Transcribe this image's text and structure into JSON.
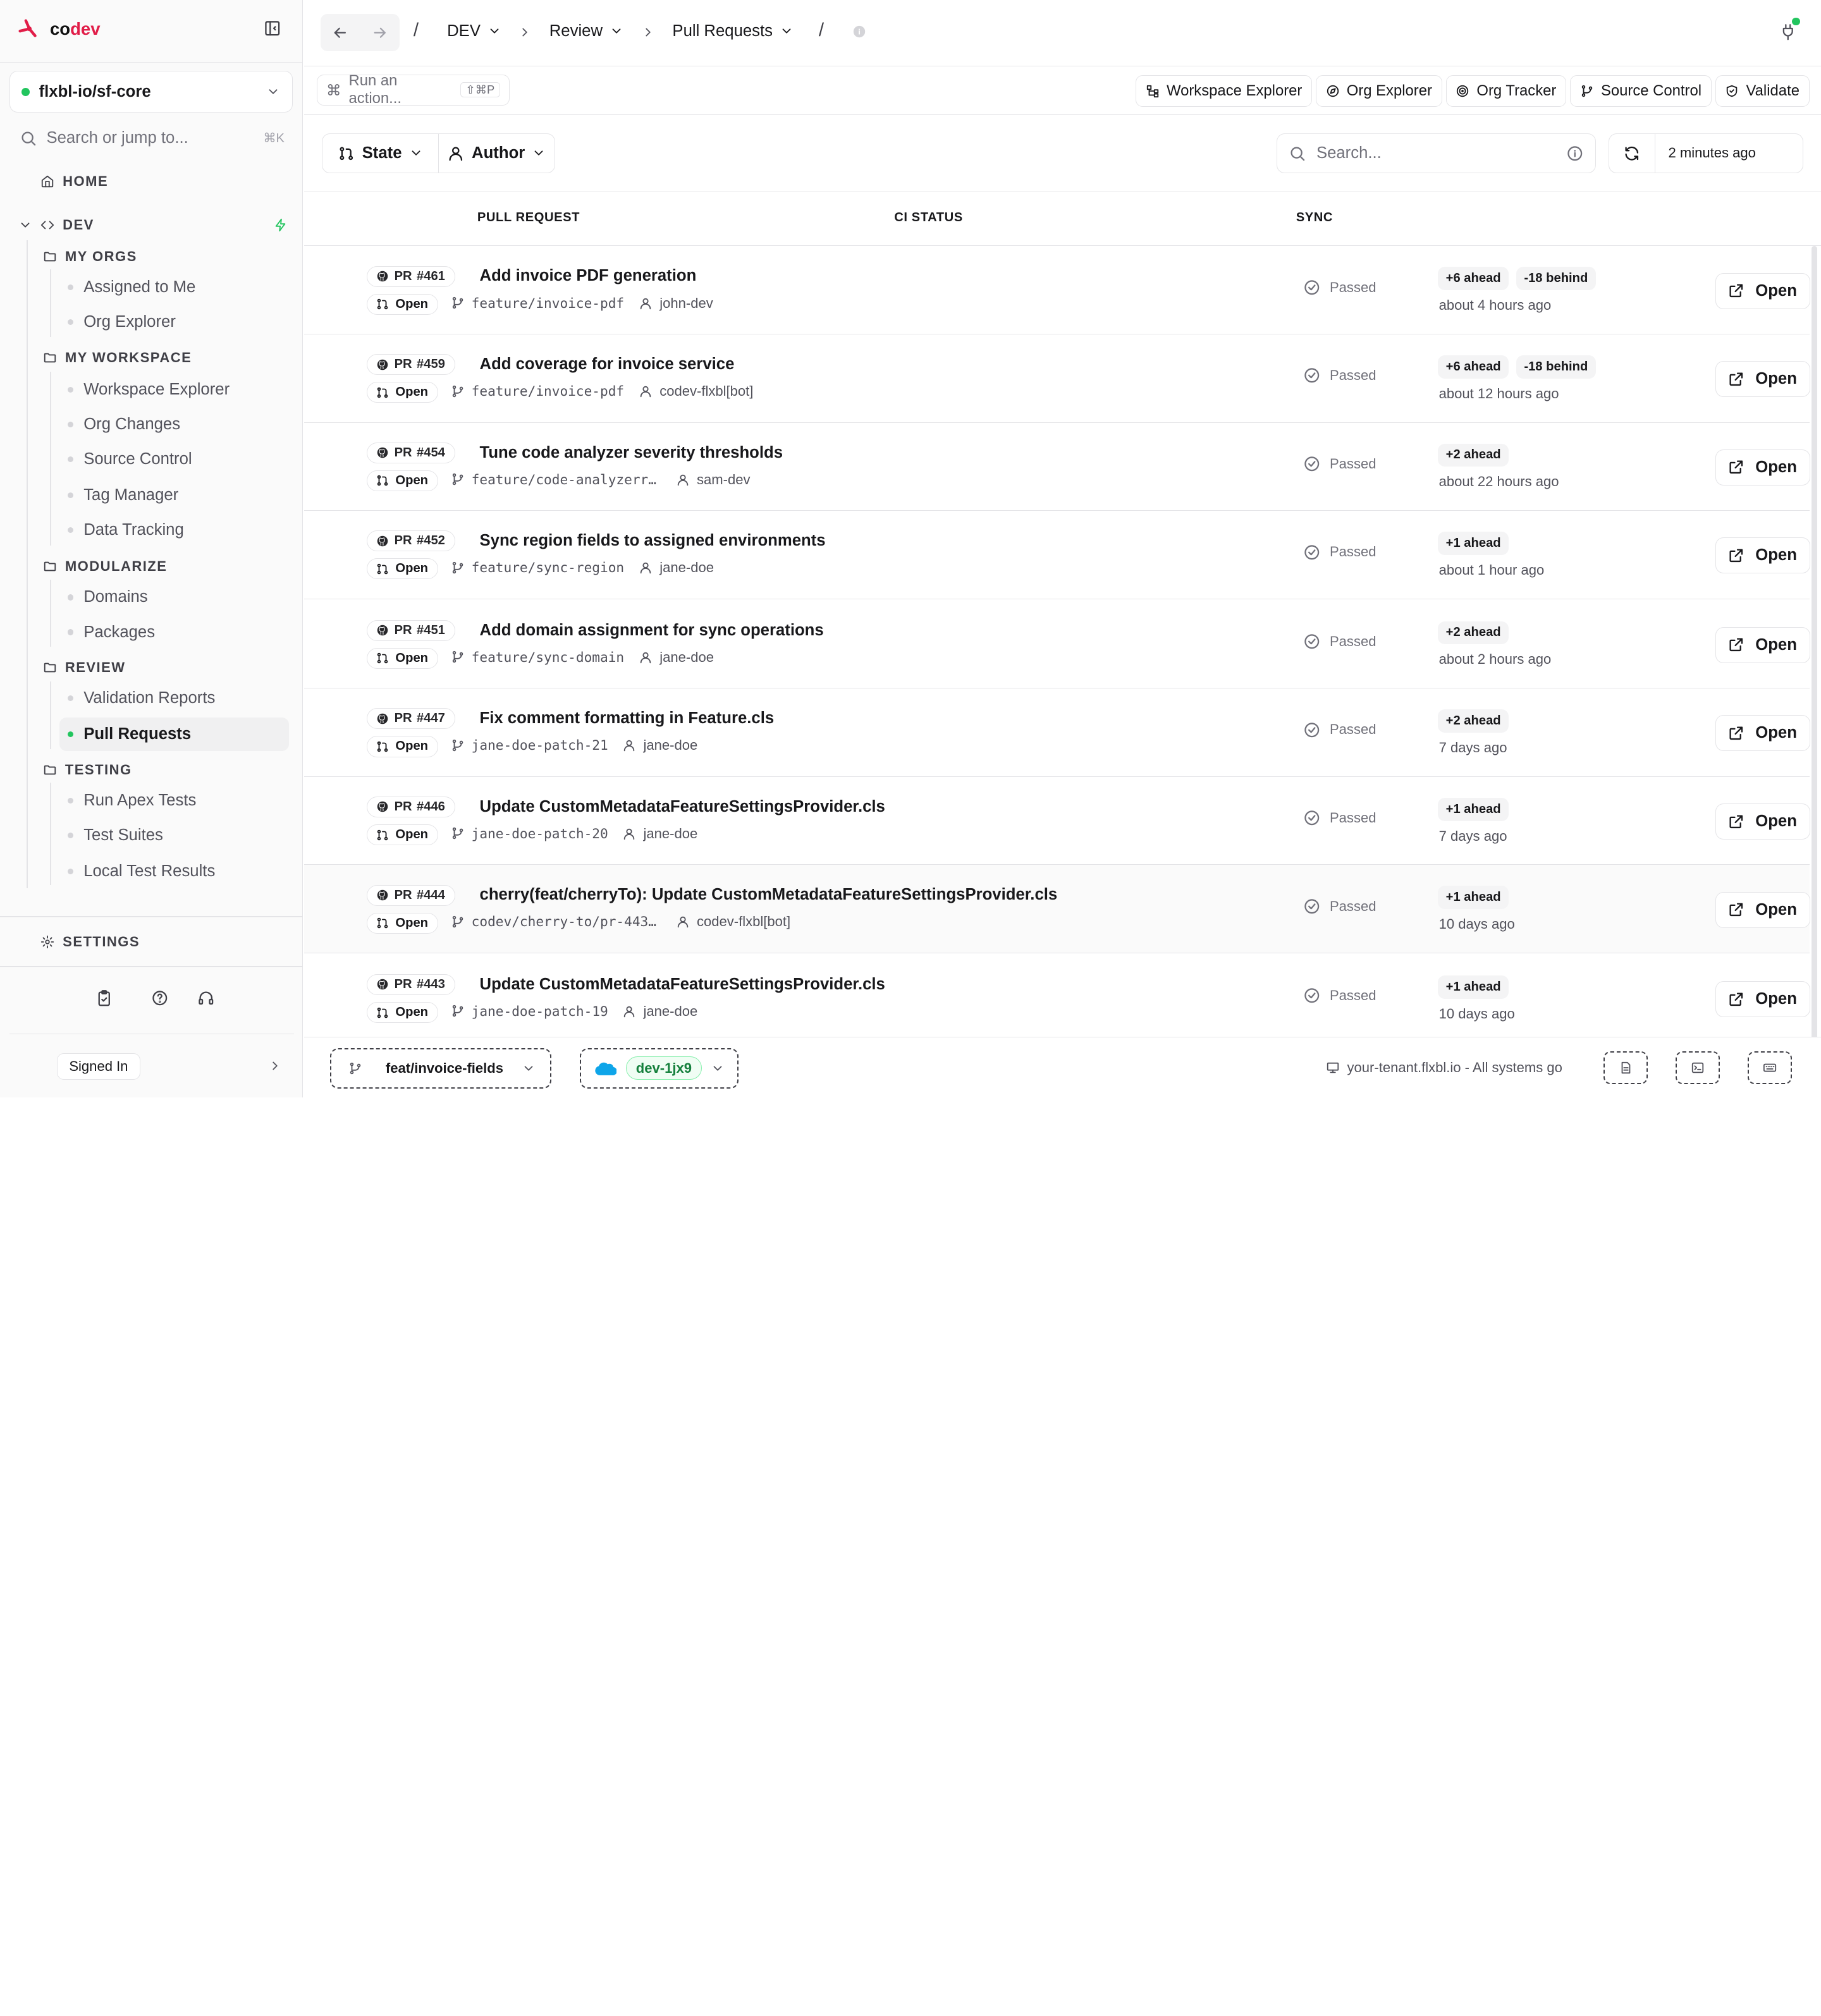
{
  "brand": {
    "name_left": "co",
    "name_right": "dev"
  },
  "workspace": {
    "name": "flxbl-io/sf-core"
  },
  "sidebar": {
    "search_placeholder": "Search or jump to...",
    "search_shortcut": "⌘K",
    "home": "HOME",
    "dev": "DEV",
    "groups": [
      {
        "label": "MY ORGS",
        "items": [
          "Assigned to Me",
          "Org Explorer"
        ]
      },
      {
        "label": "MY WORKSPACE",
        "items": [
          "Workspace Explorer",
          "Org Changes",
          "Source Control",
          "Tag Manager",
          "Data Tracking"
        ]
      },
      {
        "label": "MODULARIZE",
        "items": [
          "Domains",
          "Packages"
        ]
      },
      {
        "label": "REVIEW",
        "items": [
          "Validation Reports",
          "Pull Requests"
        ]
      },
      {
        "label": "TESTING",
        "items": [
          "Run Apex Tests",
          "Test Suites",
          "Local Test Results"
        ]
      }
    ],
    "active_item": "Pull Requests",
    "settings": "SETTINGS",
    "signed_in": "Signed In"
  },
  "breadcrumb": {
    "items": [
      "DEV",
      "Review",
      "Pull Requests"
    ]
  },
  "toolbar": {
    "action_placeholder": "Run an action...",
    "action_shortcut": "⇧⌘P",
    "buttons": [
      "Workspace Explorer",
      "Org Explorer",
      "Org Tracker",
      "Source Control",
      "Validate"
    ]
  },
  "filters": {
    "state": "State",
    "author": "Author"
  },
  "search": {
    "placeholder": "Search..."
  },
  "refresh": {
    "label": "2 minutes ago"
  },
  "table": {
    "columns": [
      "PULL REQUEST",
      "CI STATUS",
      "SYNC"
    ],
    "open_label": "Open",
    "rows": [
      {
        "pr_label": "PR",
        "number": "#461",
        "title": "Add invoice PDF generation",
        "state": "Open",
        "branch": "feature/invoice-pdf",
        "author": "john-dev",
        "ci": "Passed",
        "ahead": "+6 ahead",
        "behind": "-18 behind",
        "time": "about 4 hours ago"
      },
      {
        "pr_label": "PR",
        "number": "#459",
        "title": "Add coverage for invoice service",
        "state": "Open",
        "branch": "feature/invoice-pdf",
        "author": "codev-flxbl[bot]",
        "ci": "Passed",
        "ahead": "+6 ahead",
        "behind": "-18 behind",
        "time": "about 12 hours ago"
      },
      {
        "pr_label": "PR",
        "number": "#454",
        "title": "Tune code analyzer severity thresholds",
        "state": "Open",
        "branch": "feature/code-analyzerr…",
        "author": "sam-dev",
        "ci": "Passed",
        "ahead": "+2 ahead",
        "behind": "",
        "time": "about 22 hours ago"
      },
      {
        "pr_label": "PR",
        "number": "#452",
        "title": "Sync region fields to assigned environments",
        "state": "Open",
        "branch": "feature/sync-region",
        "author": "jane-doe",
        "ci": "Passed",
        "ahead": "+1 ahead",
        "behind": "",
        "time": "about 1 hour ago"
      },
      {
        "pr_label": "PR",
        "number": "#451",
        "title": "Add domain assignment for sync operations",
        "state": "Open",
        "branch": "feature/sync-domain",
        "author": "jane-doe",
        "ci": "Passed",
        "ahead": "+2 ahead",
        "behind": "",
        "time": "about 2 hours ago"
      },
      {
        "pr_label": "PR",
        "number": "#447",
        "title": "Fix comment formatting in Feature.cls",
        "state": "Open",
        "branch": "jane-doe-patch-21",
        "author": "jane-doe",
        "ci": "Passed",
        "ahead": "+2 ahead",
        "behind": "",
        "time": "7 days ago"
      },
      {
        "pr_label": "PR",
        "number": "#446",
        "title": "Update CustomMetadataFeatureSettingsProvider.cls",
        "state": "Open",
        "branch": "jane-doe-patch-20",
        "author": "jane-doe",
        "ci": "Passed",
        "ahead": "+1 ahead",
        "behind": "",
        "time": "7 days ago"
      },
      {
        "pr_label": "PR",
        "number": "#444",
        "title": "cherry(feat/cherryTo): Update CustomMetadataFeatureSettingsProvider.cls",
        "state": "Open",
        "branch": "codev/cherry-to/pr-443…",
        "author": "codev-flxbl[bot]",
        "ci": "Passed",
        "ahead": "+1 ahead",
        "behind": "",
        "time": "10 days ago"
      },
      {
        "pr_label": "PR",
        "number": "#443",
        "title": "Update CustomMetadataFeatureSettingsProvider.cls",
        "state": "Open",
        "branch": "jane-doe-patch-19",
        "author": "jane-doe",
        "ci": "Passed",
        "ahead": "+1 ahead",
        "behind": "",
        "time": "10 days ago"
      }
    ]
  },
  "bottom": {
    "branch": "feat/invoice-fields",
    "org": "dev-1jx9",
    "status": "your-tenant.flxbl.io - All systems go"
  },
  "colors": {
    "accent": "#e11d48",
    "success": "#22c55e",
    "border": "#e4e4e7"
  }
}
